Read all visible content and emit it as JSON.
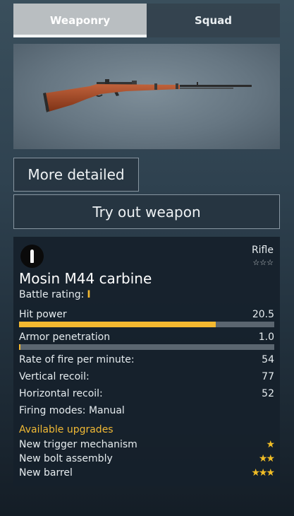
{
  "tabs": [
    {
      "label": "Weaponry",
      "active": true
    },
    {
      "label": "Squad",
      "active": false
    }
  ],
  "buttons": {
    "more_detailed": "More detailed",
    "try_out": "Try out weapon"
  },
  "weapon": {
    "type": "Rifle",
    "rank_stars": "☆☆☆",
    "name": "Mosin M44 carbine",
    "battle_rating_label": "Battle rating:",
    "battle_rating_value": "I",
    "ammo_icon": "bullet-icon"
  },
  "stats": {
    "hit_power": {
      "label": "Hit power",
      "value": "20.5",
      "bar_fraction": 0.77
    },
    "armor_penetration": {
      "label": "Armor penetration",
      "value": "1.0",
      "bar_fraction": 0.005
    },
    "rate_of_fire": {
      "label": "Rate of fire per minute:",
      "value": "54"
    },
    "vertical_recoil": {
      "label": "Vertical recoil:",
      "value": "77"
    },
    "horizontal_recoil": {
      "label": "Horizontal recoil:",
      "value": "52"
    },
    "firing_modes": {
      "label": "Firing modes: Manual"
    }
  },
  "upgrades": {
    "title": "Available upgrades",
    "items": [
      {
        "label": "New trigger mechanism",
        "stars": "★"
      },
      {
        "label": "New bolt assembly",
        "stars": "★★"
      },
      {
        "label": "New barrel",
        "stars": "★★★"
      }
    ]
  },
  "colors": {
    "accent": "#f4b930",
    "panel": "#16212b",
    "tab_active": "#b9bec1"
  }
}
